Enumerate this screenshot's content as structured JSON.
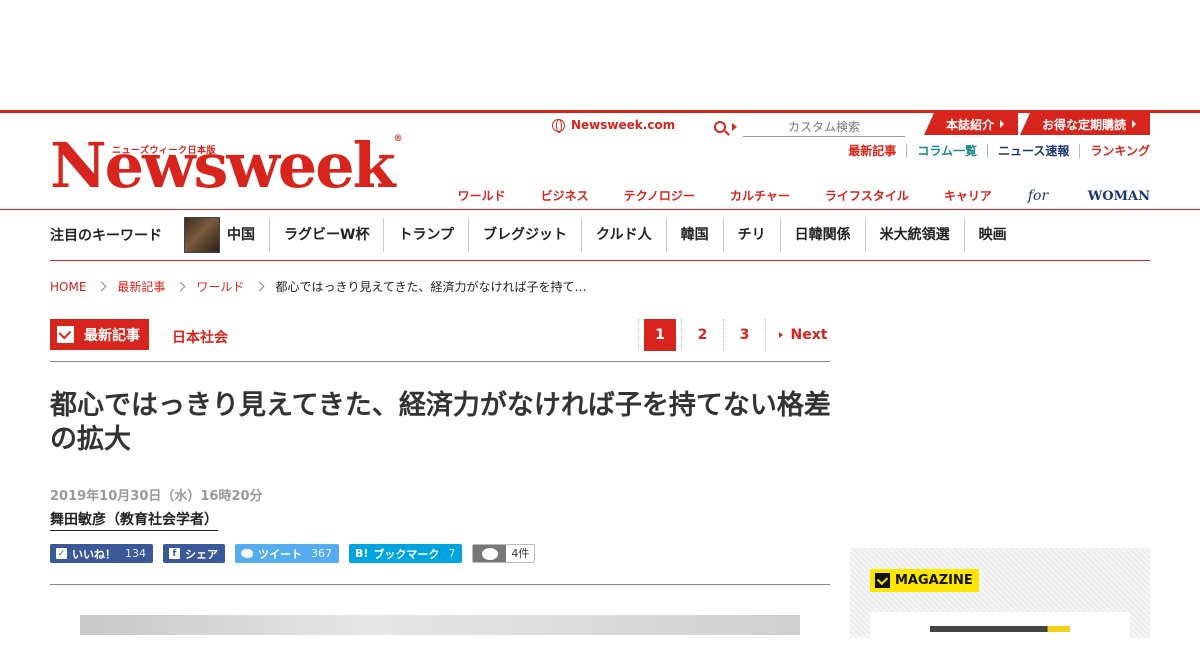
{
  "header": {
    "logo_kana": "ニューズウィーク日本版",
    "logo_word": "Newsweek",
    "logo_reg": "®",
    "site_link": "Newsweek.com",
    "search_placeholder": "カスタム検索",
    "promo_tabs": [
      "本誌紹介",
      "お得な定期購読"
    ],
    "util_links": [
      "最新記事",
      "コラム一覧",
      "ニュース速報",
      "ランキング"
    ],
    "main_nav": [
      "ワールド",
      "ビジネス",
      "テクノロジー",
      "カルチャー",
      "ライフスタイル",
      "キャリア"
    ],
    "for_woman_italic": "for",
    "for_woman_word": "WOMAN"
  },
  "keywords": {
    "title": "注目のキーワード",
    "items": [
      "中国",
      "ラグビーW杯",
      "トランプ",
      "ブレグジット",
      "クルド人",
      "韓国",
      "チリ",
      "日韓関係",
      "米大統領選",
      "映画"
    ]
  },
  "breadcrumb": {
    "items": [
      "HOME",
      "最新記事",
      "ワールド"
    ],
    "current": "都心ではっきり見えてきた、経済力がなければ子を持て…"
  },
  "section": {
    "badge": "最新記事",
    "category": "日本社会"
  },
  "pagination": {
    "pages": [
      "1",
      "2",
      "3"
    ],
    "current": "1",
    "next": "Next"
  },
  "article": {
    "title": "都心ではっきり見えてきた、経済力がなければ子を持てない格差の拡大",
    "date": "2019年10月30日（水）16時20分",
    "author": "舞田敏彦（教育社会学者）"
  },
  "share": {
    "facebook_like": "いいね！",
    "facebook_like_count": "134",
    "facebook_share": "シェア",
    "tweet": "ツイート",
    "tweet_count": "367",
    "hatena_icon": "B!",
    "bookmark": "ブックマーク",
    "bookmark_count": "7",
    "comments": "4件"
  },
  "sidebar": {
    "magazine_label": "MAGAZINE"
  },
  "colors": {
    "brand_red": "#d7251d",
    "facebook": "#3b5998",
    "twitter": "#55acee",
    "hatena": "#00a4de",
    "magazine_yellow": "#ffe600"
  }
}
